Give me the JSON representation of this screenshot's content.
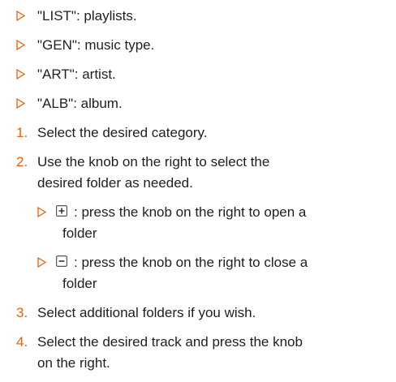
{
  "colors": {
    "accent": "#e8600a",
    "text": "#1e1e1e",
    "icon_border": "#555555"
  },
  "bullets": [
    {
      "text": "\"LIST\": playlists."
    },
    {
      "text": "\"GEN\": music type."
    },
    {
      "text": "\"ART\": artist."
    },
    {
      "text": "\"ALB\": album."
    }
  ],
  "steps": [
    {
      "num": "1.",
      "line1": "Select the desired category."
    },
    {
      "num": "2.",
      "line1": "Use the knob on the right to select the",
      "line2": "desired folder as needed."
    },
    {
      "num": "3.",
      "line1": "Select additional folders if you wish."
    },
    {
      "num": "4.",
      "line1": "Select the desired track and press the knob",
      "line2": "on the right."
    }
  ],
  "sub_bullets": [
    {
      "icon": "plus-box-icon",
      "line1": ": press the knob on the right to open a",
      "line2": "folder"
    },
    {
      "icon": "minus-box-icon",
      "line1": ": press the knob on the right to close a",
      "line2": "folder"
    }
  ]
}
